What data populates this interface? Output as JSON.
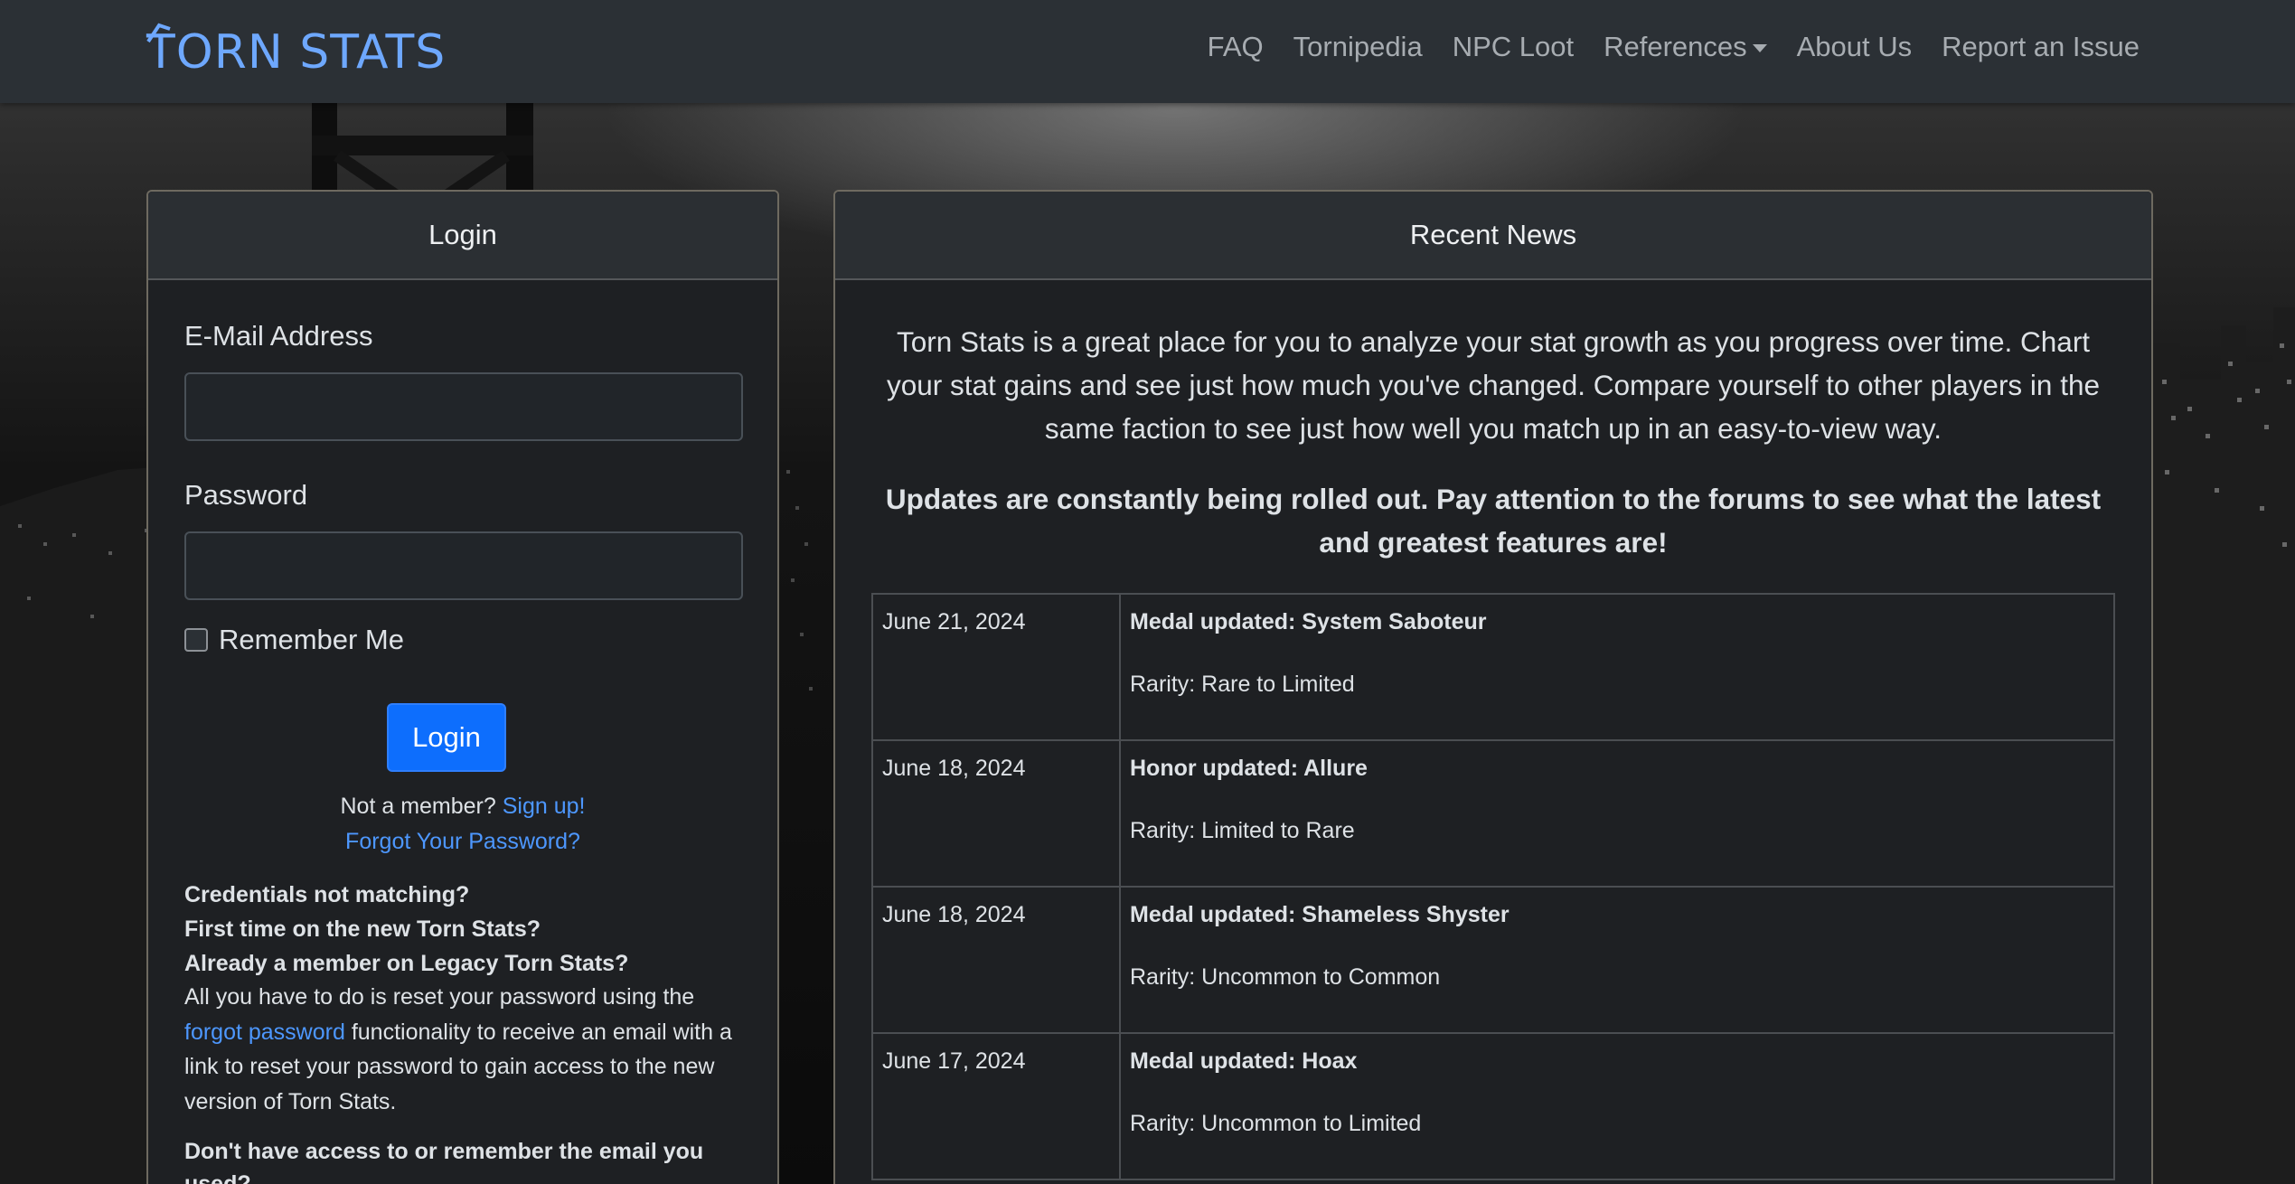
{
  "brand": {
    "name": "TORN STATS",
    "color": "#6ea8fe"
  },
  "nav": {
    "items": [
      {
        "label": "FAQ"
      },
      {
        "label": "Tornipedia"
      },
      {
        "label": "NPC Loot"
      },
      {
        "label": "References",
        "dropdown": true
      },
      {
        "label": "About Us"
      },
      {
        "label": "Report an Issue"
      }
    ]
  },
  "login": {
    "header": "Login",
    "email_label": "E-Mail Address",
    "email_value": "",
    "password_label": "Password",
    "password_value": "",
    "remember_label": "Remember Me",
    "remember_checked": false,
    "submit_label": "Login",
    "not_member_text": "Not a member?",
    "signup_link": "Sign up!",
    "forgot_link": "Forgot Your Password?",
    "help": {
      "q1": "Credentials not matching?",
      "q2": "First time on the new Torn Stats?",
      "q3": "Already a member on Legacy Torn Stats?",
      "p_before": "All you have to do is reset your password using the",
      "p_link": "forgot password",
      "p_after": "functionality to receive an email with a link to reset your password to gain access to the new version of Torn Stats.",
      "q4": "Don't have access to or remember the email you used?"
    }
  },
  "news": {
    "header": "Recent News",
    "intro": "Torn Stats is a great place for you to analyze your stat growth as you progress over time. Chart your stat gains and see just how much you've changed. Compare yourself to other players in the same faction to see just how well you match up in an easy-to-view way.",
    "notice": "Updates are constantly being rolled out. Pay attention to the forums to see what the latest and greatest features are!",
    "items": [
      {
        "date": "June 21, 2024",
        "title": "Medal updated: System Saboteur",
        "detail": "Rarity: Rare to Limited"
      },
      {
        "date": "June 18, 2024",
        "title": "Honor updated: Allure",
        "detail": "Rarity: Limited to Rare"
      },
      {
        "date": "June 18, 2024",
        "title": "Medal updated: Shameless Shyster",
        "detail": "Rarity: Uncommon to Common"
      },
      {
        "date": "June 17, 2024",
        "title": "Medal updated: Hoax",
        "detail": "Rarity: Uncommon to Limited"
      }
    ]
  },
  "colors": {
    "navbar_bg": "#2b3035",
    "card_bg": "#1e2023",
    "link": "#4d97fe",
    "primary_button": "#0d6efd"
  }
}
